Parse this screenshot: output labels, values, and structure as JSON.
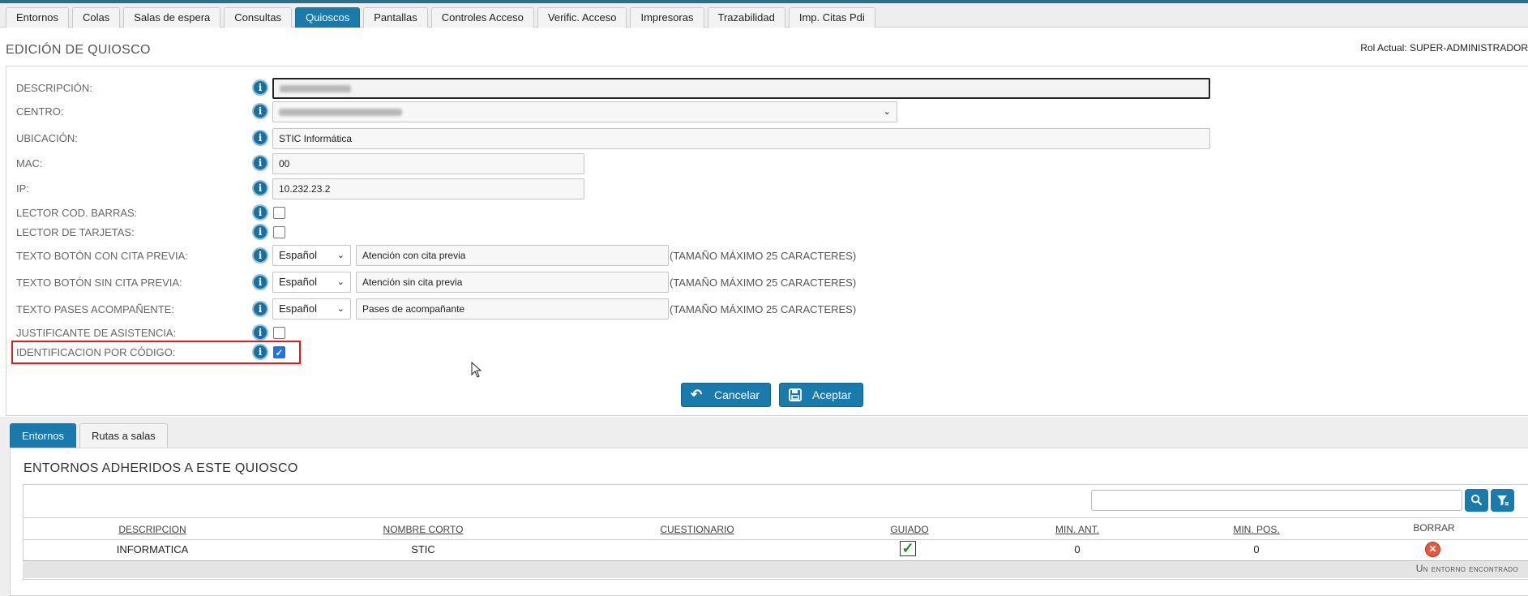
{
  "tabs": [
    {
      "label": "Entornos",
      "active": false
    },
    {
      "label": "Colas",
      "active": false
    },
    {
      "label": "Salas de espera",
      "active": false
    },
    {
      "label": "Consultas",
      "active": false
    },
    {
      "label": "Quioscos",
      "active": true
    },
    {
      "label": "Pantallas",
      "active": false
    },
    {
      "label": "Controles Acceso",
      "active": false
    },
    {
      "label": "Verific. Acceso",
      "active": false
    },
    {
      "label": "Impresoras",
      "active": false
    },
    {
      "label": "Trazabilidad",
      "active": false
    },
    {
      "label": "Imp. Citas Pdi",
      "active": false
    }
  ],
  "page": {
    "title": "EDICIÓN DE QUIOSCO",
    "role": "Rol Actual: SUPER-ADMINISTRADOR"
  },
  "form": {
    "descripcion_label": "DESCRIPCIÓN:",
    "centro_label": "CENTRO:",
    "ubicacion_label": "UBICACIÓN:",
    "ubicacion_value": "STIC Informática",
    "mac_label": "MAC:",
    "mac_value": "00",
    "ip_label": "IP:",
    "ip_value": "10.232.23.2",
    "lector_barras_label": "LECTOR COD. BARRAS:",
    "lector_barras_checked": false,
    "lector_tarjetas_label": "LECTOR DE TARJETAS:",
    "lector_tarjetas_checked": false,
    "con_cita_label": "TEXTO BOTÓN CON CITA PREVIA:",
    "con_cita_lang": "Español",
    "con_cita_value": "Atención con cita previa",
    "sin_cita_label": "TEXTO BOTÓN SIN CITA PREVIA:",
    "sin_cita_lang": "Español",
    "sin_cita_value": "Atención sin cita previa",
    "pases_label": "TEXTO PASES ACOMPAÑENTE:",
    "pases_lang": "Español",
    "pases_value": "Pases de acompañante",
    "max_hint": "(TAMAÑO MÁXIMO 25 CARACTERES)",
    "justificante_label": "JUSTIFICANTE DE ASISTENCIA:",
    "justificante_checked": false,
    "identificacion_label": "IDENTIFICACION POR CÓDIGO:",
    "identificacion_checked": true,
    "cancel_label": "Cancelar",
    "accept_label": "Aceptar"
  },
  "lower_tabs": [
    {
      "label": "Entornos",
      "active": true
    },
    {
      "label": "Rutas a salas",
      "active": false
    }
  ],
  "entornos": {
    "section_title": "ENTORNOS ADHERIDOS A ESTE QUIOSCO",
    "columns": [
      "DESCRIPCION",
      "NOMBRE CORTO",
      "CUESTIONARIO",
      "GUIADO",
      "MIN. ANT.",
      "MIN. POS.",
      "BORRAR"
    ],
    "rows": [
      {
        "descripcion": "INFORMATICA",
        "nombre_corto": "STIC",
        "cuestionario": "",
        "guiado": true,
        "min_ant": "0",
        "min_pos": "0"
      }
    ],
    "footer": "Un entorno encontrado"
  },
  "icons": {
    "info": "info-icon",
    "cancel": "undo-arrow-icon",
    "accept": "floppy-disk-icon",
    "search": "search-icon",
    "filter": "filter-icon",
    "guiado": "checkmark-icon",
    "delete": "delete-x-icon"
  },
  "colors": {
    "accent": "#1a7aab",
    "highlight": "#e11b1b"
  }
}
